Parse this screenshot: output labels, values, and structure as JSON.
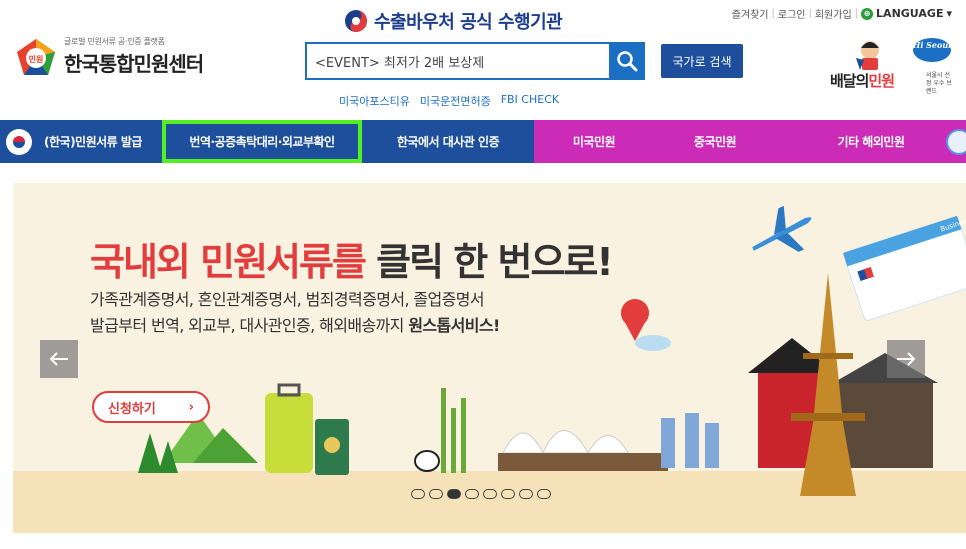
{
  "header": {
    "logo": {
      "sub": "글로벌 민원서류 공·인증 플랫폼",
      "title": "한국통합민원센터",
      "mark_text": "민원"
    },
    "slogan": "수출바우처 공식 수행기관",
    "top_links": [
      "즐겨찾기",
      "로그인",
      "회원가입"
    ],
    "language": "LANGUAGE",
    "search": {
      "placeholder": "<EVENT> 최저가 2배 보상제",
      "value": "<EVENT> 최저가 2배 보상제"
    },
    "country_search_button": "국가로 검색",
    "quick_links": [
      "미국아포스티유",
      "미국운전면허증",
      "FBI CHECK"
    ],
    "partner": {
      "name_part1": "배달의",
      "name_part2": "민원",
      "hi": "Hi Seoul",
      "sub": "서울시 선정 우수 브랜드"
    }
  },
  "nav": {
    "items": [
      {
        "label": "(한국)민원서류 발급"
      },
      {
        "label": "번역·공증촉탁대리·외교부확인"
      },
      {
        "label": "한국에서 대사관 인증"
      },
      {
        "label": "미국민원"
      },
      {
        "label": "중국민원"
      },
      {
        "label": "기타 해외민원"
      }
    ]
  },
  "banner": {
    "headline_red": "국내외 민원서류를",
    "headline_dark": "클릭 한 번으로!",
    "line1": "가족관계증명서, 혼인관계증명서, 범죄경력증명서, 졸업증명서",
    "line2_prefix": "발급부터 번역, 외교부, 대사관인증, 해외배송까지",
    "line2_bold": "원스톱서비스!",
    "apply_label": "신청하기",
    "apply_arrow": "›",
    "prev": "←",
    "next": "→",
    "ticket_label": "Business",
    "slides": 8,
    "active_slide": 3
  },
  "colors": {
    "primary": "#1d4f9c",
    "accent": "#cc2bb8",
    "highlight": "#55ee22",
    "red": "#e23c3c"
  }
}
